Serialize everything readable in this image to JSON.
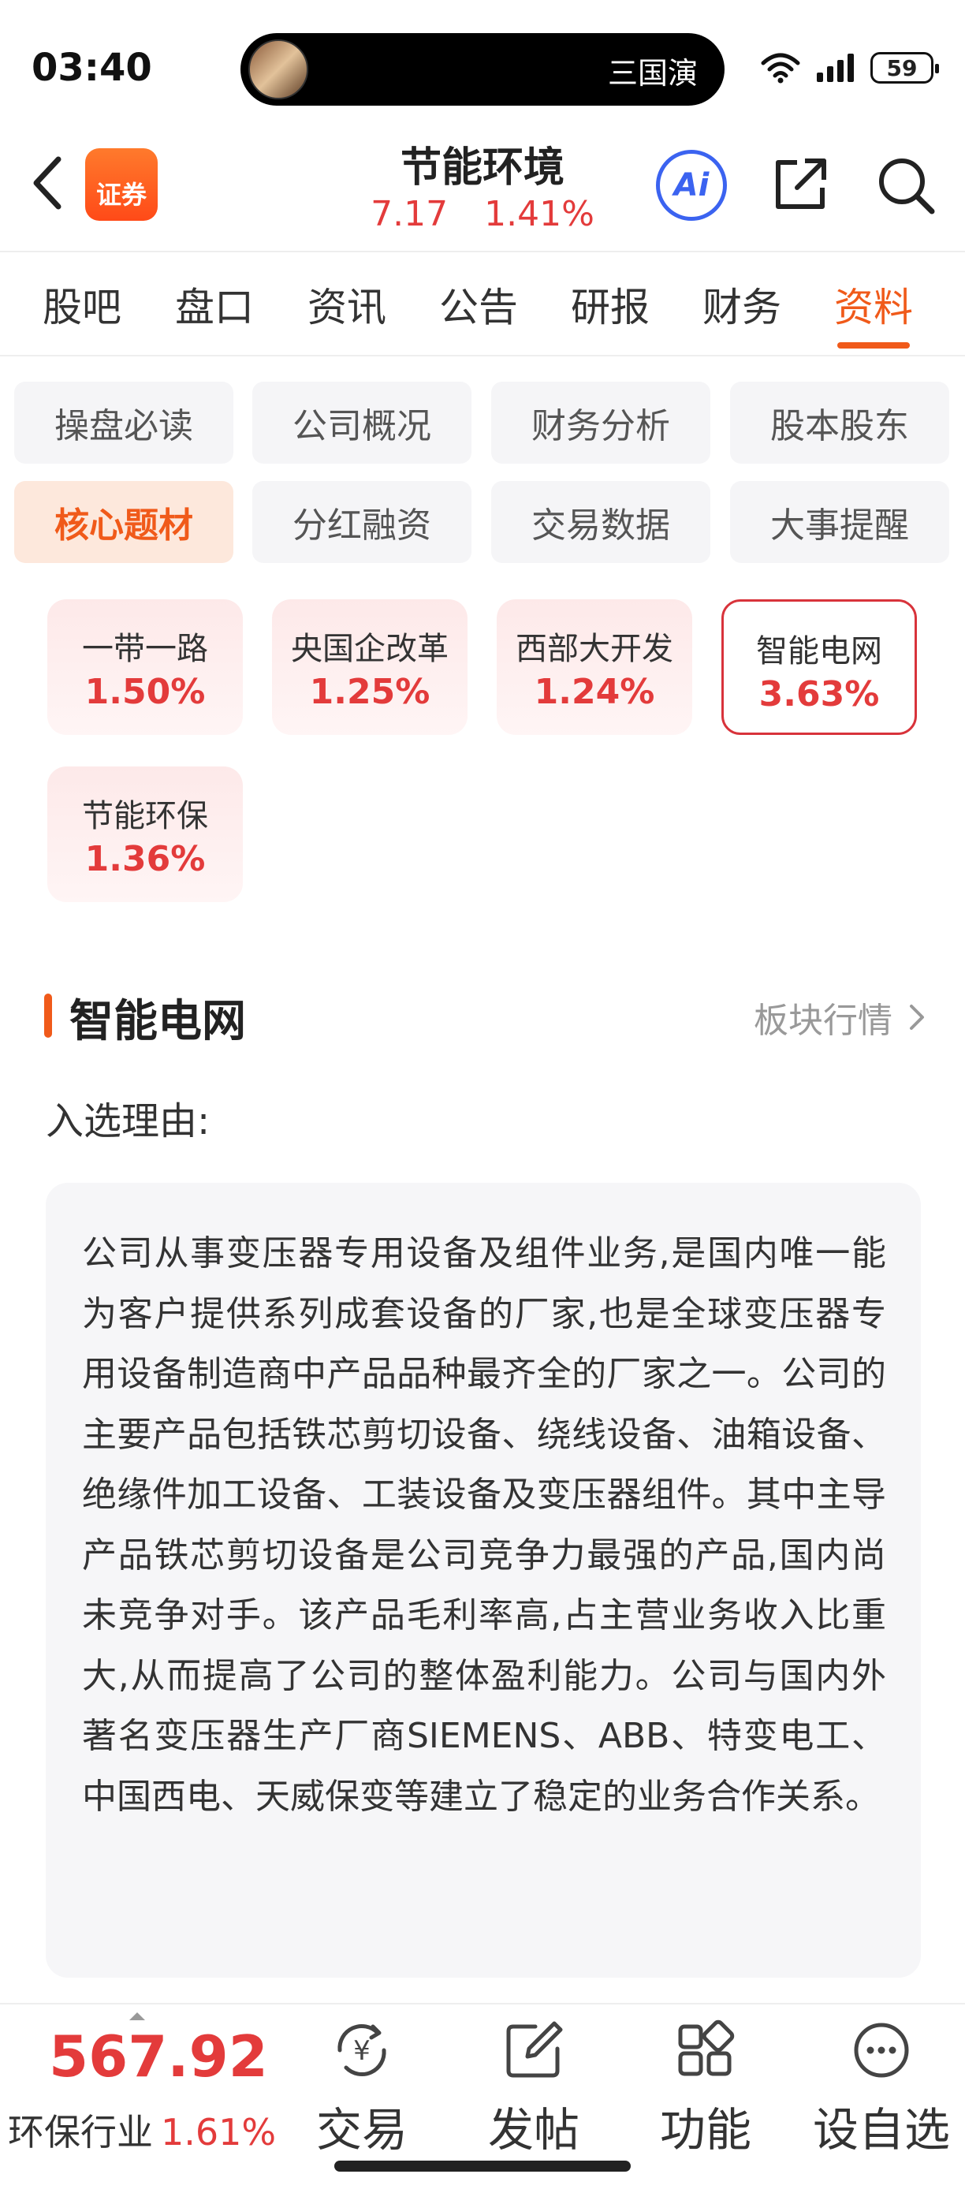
{
  "status_bar": {
    "time": "03:40",
    "island_text": "三国演",
    "battery": "59",
    "icons": [
      "wifi-icon",
      "signal-icon",
      "battery-icon"
    ]
  },
  "header": {
    "app_badge": "证券",
    "stock_name": "节能环境",
    "price": "7.17",
    "change_pct": "1.41%",
    "ai_label": "Ai",
    "accent_color": "#f05a1a",
    "up_color": "#e33b3b"
  },
  "tabs": [
    {
      "label": "股吧"
    },
    {
      "label": "盘口"
    },
    {
      "label": "资讯"
    },
    {
      "label": "公告"
    },
    {
      "label": "研报"
    },
    {
      "label": "财务"
    },
    {
      "label": "资料",
      "active": true
    }
  ],
  "sub_menu": [
    {
      "label": "操盘必读"
    },
    {
      "label": "公司概况"
    },
    {
      "label": "财务分析"
    },
    {
      "label": "股本股东"
    },
    {
      "label": "核心题材",
      "active": true
    },
    {
      "label": "分红融资"
    },
    {
      "label": "交易数据"
    },
    {
      "label": "大事提醒"
    }
  ],
  "concepts": [
    {
      "name": "一带一路",
      "pct": "1.50%"
    },
    {
      "name": "央国企改革",
      "pct": "1.25%"
    },
    {
      "name": "西部大开发",
      "pct": "1.24%"
    },
    {
      "name": "智能电网",
      "pct": "3.63%",
      "selected": true
    },
    {
      "name": "节能环保",
      "pct": "1.36%"
    }
  ],
  "section": {
    "title": "智能电网",
    "link": "板块行情",
    "reason_label": "入选理由:",
    "reason_text": "公司从事变压器专用设备及组件业务,是国内唯一能为客户提供系列成套设备的厂家,也是全球变压器专用设备制造商中产品品种最齐全的厂家之一。公司的主要产品包括铁芯剪切设备、绕线设备、油箱设备、绝缘件加工设备、工装设备及变压器组件。其中主导产品铁芯剪切设备是公司竞争力最强的产品,国内尚未竞争对手。该产品毛利率高,占主营业务收入比重大,从而提高了公司的整体盈利能力。公司与国内外著名变压器生产厂商SIEMENS、ABB、特变电工、中国西电、天威保变等建立了稳定的业务合作关系。"
  },
  "bottom": {
    "index_value": "567.92",
    "index_name": "环保行业",
    "index_pct": "1.61%",
    "nav": [
      {
        "label": "交易",
        "icon": "yen-refresh-icon"
      },
      {
        "label": "发帖",
        "icon": "edit-icon"
      },
      {
        "label": "功能",
        "icon": "grid-icon"
      },
      {
        "label": "设自选",
        "icon": "more-icon"
      }
    ]
  }
}
